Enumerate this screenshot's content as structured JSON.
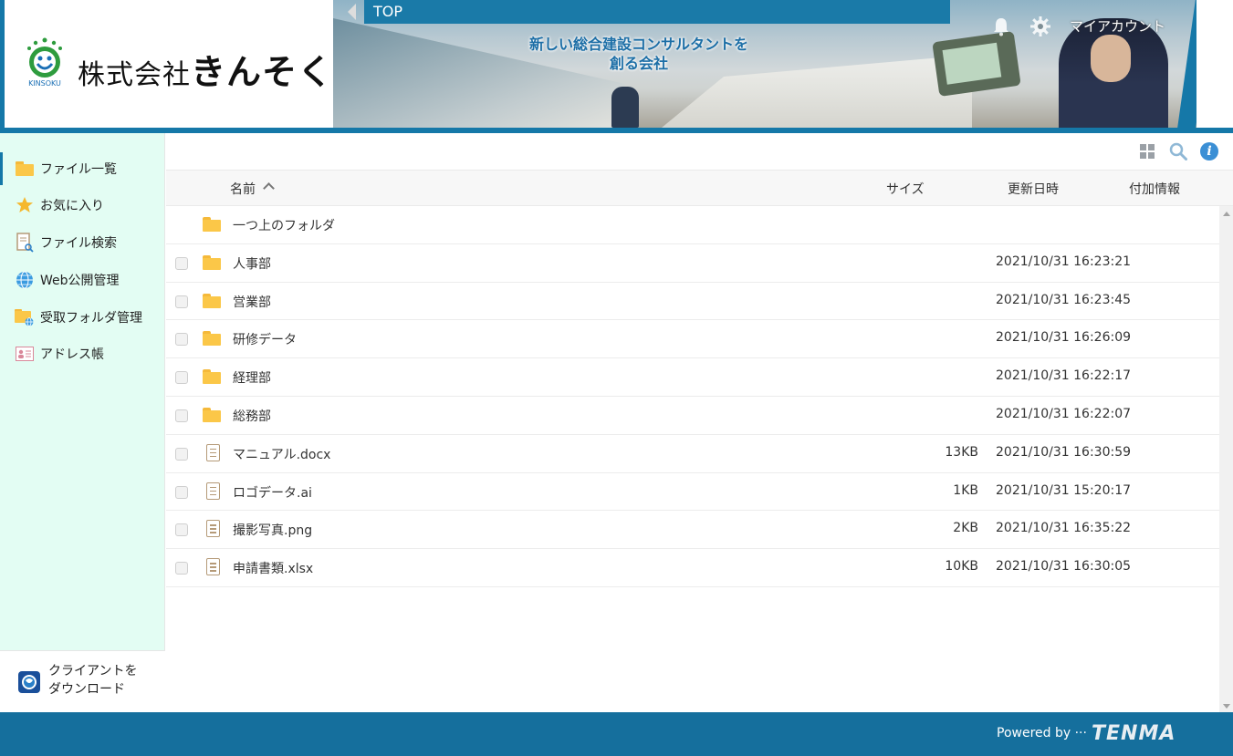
{
  "header": {
    "logo_text_small": "株式会社",
    "logo_text_big": "きんそく",
    "logo_mark_text": "KINSOKU",
    "tagline_line1": "新しい総合建設コンサルタントを",
    "tagline_line2": "創る会社",
    "breadcrumb": "TOP",
    "account_label": "マイアカウント"
  },
  "sidebar": {
    "items": [
      {
        "label": "ファイル一覧",
        "icon": "folder-icon"
      },
      {
        "label": "お気に入り",
        "icon": "star-icon"
      },
      {
        "label": "ファイル検索",
        "icon": "file-search-icon"
      },
      {
        "label": "Web公開管理",
        "icon": "globe-icon"
      },
      {
        "label": "受取フォルダ管理",
        "icon": "inbox-folder-icon"
      },
      {
        "label": "アドレス帳",
        "icon": "address-book-icon"
      }
    ],
    "client_download_line1": "クライアントを",
    "client_download_line2": "ダウンロード"
  },
  "table": {
    "headers": {
      "name": "名前",
      "size": "サイズ",
      "updated": "更新日時",
      "extra": "付加情報"
    },
    "up_folder": "一つ上のフォルダ",
    "rows": [
      {
        "name": "人事部",
        "type": "folder",
        "size": "",
        "updated": "2021/10/31 16:23:21"
      },
      {
        "name": "営業部",
        "type": "folder",
        "size": "",
        "updated": "2021/10/31 16:23:45"
      },
      {
        "name": "研修データ",
        "type": "folder",
        "size": "",
        "updated": "2021/10/31 16:26:09"
      },
      {
        "name": "経理部",
        "type": "folder",
        "size": "",
        "updated": "2021/10/31 16:22:17"
      },
      {
        "name": "総務部",
        "type": "folder",
        "size": "",
        "updated": "2021/10/31 16:22:07"
      },
      {
        "name": "マニュアル.docx",
        "type": "file",
        "size": "13KB",
        "updated": "2021/10/31 16:30:59"
      },
      {
        "name": "ロゴデータ.ai",
        "type": "file",
        "size": "1KB",
        "updated": "2021/10/31 15:20:17"
      },
      {
        "name": "撮影写真.png",
        "type": "file",
        "size": "2KB",
        "updated": "2021/10/31 16:35:22"
      },
      {
        "name": "申請書類.xlsx",
        "type": "file",
        "size": "10KB",
        "updated": "2021/10/31 16:30:05"
      }
    ]
  },
  "footer": {
    "powered_by": "Powered by ···",
    "brand": "TENMA"
  },
  "colors": {
    "brand_blue": "#1578a8",
    "sidebar_bg": "#e3fdf3",
    "folder": "#fbc748",
    "footer_bg": "#156f9d"
  }
}
